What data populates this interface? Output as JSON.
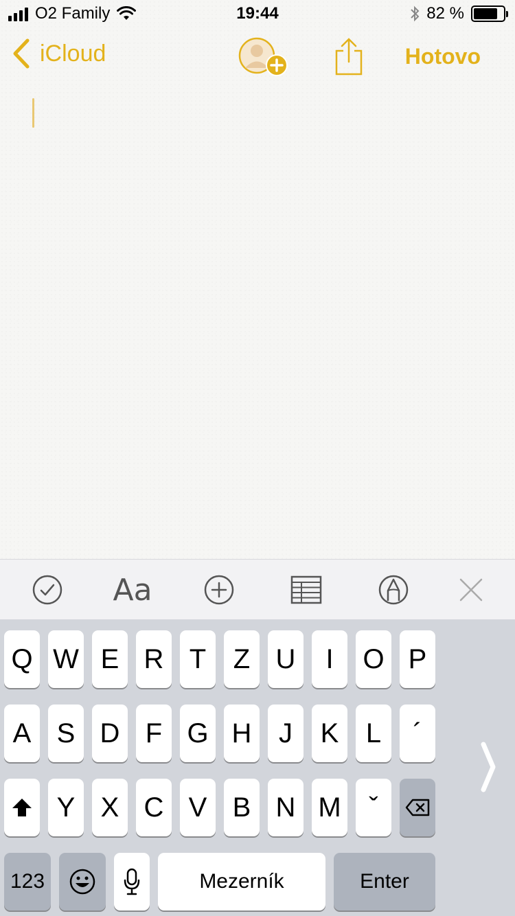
{
  "status_bar": {
    "carrier": "O2 Family",
    "time": "19:44",
    "battery": "82 %",
    "battery_level": 0.82,
    "icons": [
      "signal-icon",
      "wifi-icon",
      "bluetooth-icon",
      "battery-icon"
    ]
  },
  "navbar": {
    "back_label": "iCloud",
    "done_label": "Hotovo",
    "accent_color": "#e3b21c",
    "icons": [
      "chevron-left-icon",
      "add-person-icon",
      "share-icon"
    ]
  },
  "toolbar": {
    "format_label": "Aa",
    "icons": [
      "checklist-icon",
      "format-icon",
      "add-icon",
      "table-icon",
      "markup-icon",
      "close-icon"
    ]
  },
  "keyboard": {
    "row1": [
      "Q",
      "W",
      "E",
      "R",
      "T",
      "Z",
      "U",
      "I",
      "O",
      "P"
    ],
    "row2": [
      "A",
      "S",
      "D",
      "F",
      "G",
      "H",
      "J",
      "K",
      "L",
      "´"
    ],
    "row3": [
      "Y",
      "X",
      "C",
      "V",
      "B",
      "N",
      "M",
      "ˇ"
    ],
    "numbers_label": "123",
    "space_label": "Mezerník",
    "enter_label": "Enter",
    "icons": [
      "shift-icon",
      "backspace-icon",
      "emoji-icon",
      "microphone-icon",
      "chevron-right-icon"
    ]
  }
}
